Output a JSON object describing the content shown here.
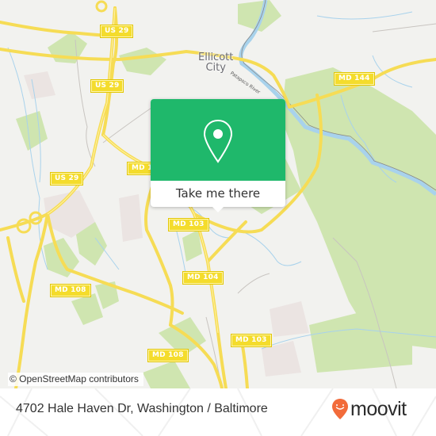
{
  "map": {
    "city_label": [
      "Ellicott",
      "City"
    ],
    "river_label": "Patapsco River",
    "road_shields": [
      {
        "id": "us29-a",
        "label": "US 29"
      },
      {
        "id": "us29-b",
        "label": "US 29"
      },
      {
        "id": "us29-c",
        "label": "US 29"
      },
      {
        "id": "md144",
        "label": "MD 144"
      },
      {
        "id": "md10x",
        "label": "MD 1"
      },
      {
        "id": "md103-a",
        "label": "MD 103"
      },
      {
        "id": "md104",
        "label": "MD 104"
      },
      {
        "id": "md108-a",
        "label": "MD 108"
      },
      {
        "id": "md108-b",
        "label": "MD 108"
      },
      {
        "id": "md103-b",
        "label": "MD 103"
      }
    ],
    "attribution": "© OpenStreetMap contributors",
    "colors": {
      "background": "#f2f2ef",
      "park": "#c9e2a6",
      "water": "#a8d2ec",
      "road": "#f6dc55",
      "shield": "#f4dc2c"
    }
  },
  "popup": {
    "icon": "map-pin-icon",
    "cta_label": "Take me there",
    "accent": "#1fb86b"
  },
  "footer": {
    "address": "4702 Hale Haven Dr, Washington / Baltimore",
    "logo_text": "moovit",
    "logo_icon": "moovit-pin-smile-icon",
    "logo_color": "#f26b3a"
  }
}
